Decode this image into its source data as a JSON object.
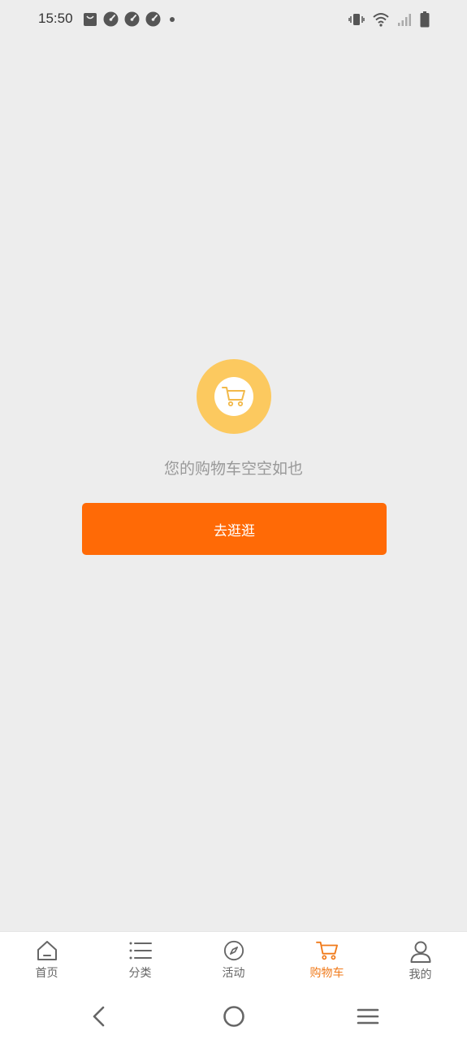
{
  "status_bar": {
    "time": "15:50",
    "left_icons": [
      "shopping-bag-icon",
      "speedometer-icon",
      "speedometer-icon",
      "speedometer-icon",
      "dot-icon"
    ],
    "right_icons": [
      "vibrate-icon",
      "wifi-icon",
      "signal-icon",
      "battery-icon"
    ]
  },
  "empty_cart": {
    "icon": "cart-icon",
    "message": "您的购物车空空如也",
    "button_label": "去逛逛"
  },
  "tabs": [
    {
      "label": "首页",
      "icon": "home-icon",
      "active": false
    },
    {
      "label": "分类",
      "icon": "list-icon",
      "active": false
    },
    {
      "label": "活动",
      "icon": "compass-icon",
      "active": false
    },
    {
      "label": "购物车",
      "icon": "cart-icon",
      "active": true
    },
    {
      "label": "我的",
      "icon": "user-icon",
      "active": false
    }
  ],
  "nav_bar": {
    "buttons": [
      "back-icon",
      "home-circle-icon",
      "menu-icon"
    ]
  },
  "colors": {
    "accent": "#ff6a06",
    "active_tab": "#f07a1a",
    "cart_circle": "#fcc95f",
    "background": "#ededed"
  }
}
